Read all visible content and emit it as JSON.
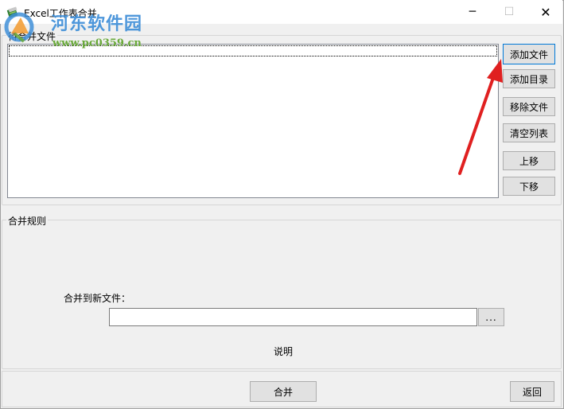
{
  "window": {
    "title": "Excel工作表合并",
    "controls": {
      "minimize": "─",
      "maximize": "☐",
      "close": "✕"
    }
  },
  "watermark": {
    "site_name": "河东软件园",
    "url": "www.pc0359.cn"
  },
  "files_group": {
    "label": "待合并文件",
    "buttons": {
      "add_file": "添加文件",
      "add_dir": "添加目录",
      "remove_file": "移除文件",
      "clear_list": "清空列表",
      "move_up": "上移",
      "move_down": "下移"
    }
  },
  "rules_group": {
    "label": "合并规则",
    "merge_to_label": "合并到新文件：",
    "output_value": "",
    "browse_label": "...",
    "help_label": "说明"
  },
  "footer": {
    "merge_label": "合并",
    "back_label": "返回"
  },
  "colors": {
    "annotation_arrow": "#e02020",
    "watermark_blue": "#3f8fd8",
    "watermark_green": "#6aaa3a",
    "focus_border": "#0078d7"
  }
}
